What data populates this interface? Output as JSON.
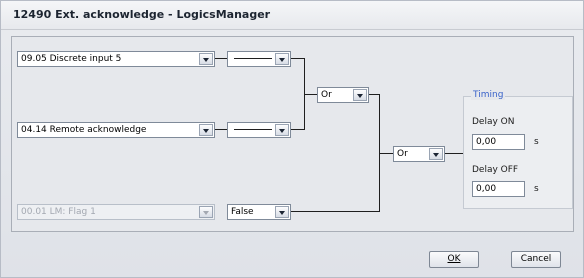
{
  "window": {
    "title": "12490 Ext. acknowledge - LogicsManager"
  },
  "inputs": {
    "input1": "09.05 Discrete input 5",
    "input2": "04.14 Remote acknowledge",
    "input3": "00.01 LM: Flag 1"
  },
  "operators": {
    "op1": "Or",
    "op2": "Or",
    "false_value": "False"
  },
  "timing": {
    "group_label": "Timing",
    "delay_on_label": "Delay ON",
    "delay_on_value": "0,00",
    "delay_on_unit": "s",
    "delay_off_label": "Delay OFF",
    "delay_off_value": "0,00",
    "delay_off_unit": "s"
  },
  "buttons": {
    "ok": "OK",
    "cancel": "Cancel"
  }
}
